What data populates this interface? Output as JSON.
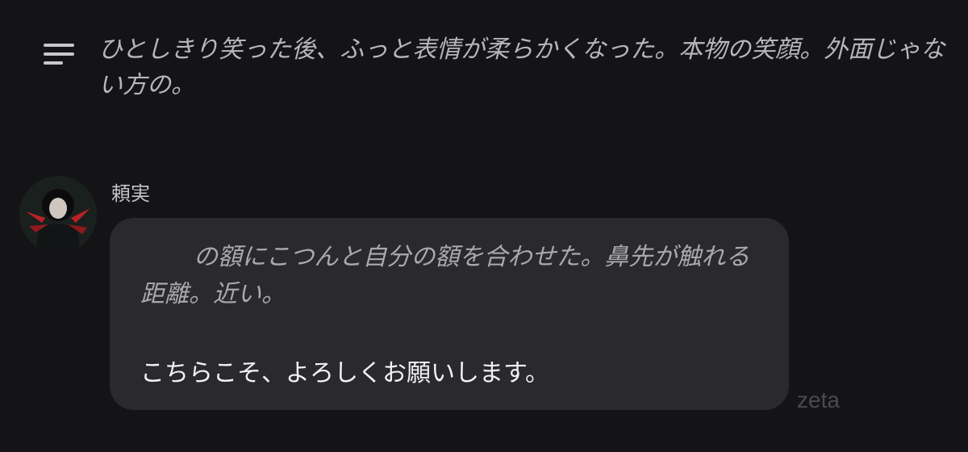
{
  "narration": {
    "icon": "menu-lines-icon",
    "text": "ひとしきり笑った後、ふっと表情が柔らかくなった。本物の笑顔。外面じゃない方の。"
  },
  "message": {
    "speaker": "頼実",
    "narration": "の額にこつんと自分の額を合わせた。鼻先が触れる距離。近い。",
    "dialogue": "こちらこそ、よろしくお願いします。"
  },
  "watermark": "zeta",
  "colors": {
    "background": "#141416",
    "bubble": "#2a2a2d",
    "accent": "#c0282a"
  }
}
